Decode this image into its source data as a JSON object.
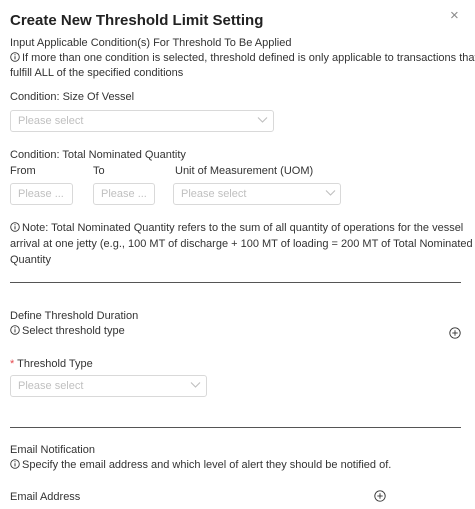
{
  "modal": {
    "title": "Create New Threshold Limit Setting",
    "close_icon": "×"
  },
  "conditions": {
    "heading": "Input Applicable Condition(s) For Threshold To Be Applied",
    "info_line1": "If more than one condition is selected, threshold defined is only applicable to transactions that",
    "info_line2": "fulfill ALL of the specified conditions"
  },
  "vessel_size": {
    "label": "Condition: Size Of Vessel",
    "placeholder": "Please select"
  },
  "nominated_quantity": {
    "label": "Condition: Total Nominated Quantity",
    "from_label": "From",
    "to_label": "To",
    "uom_label": "Unit of Measurement (UOM)",
    "from_placeholder": "Please ...",
    "to_placeholder": "Please ...",
    "uom_placeholder": "Please select",
    "note_line1": "Note: Total Nominated Quantity refers to the sum of all quantity of operations for the vessel",
    "note_line2": "arrival at one jetty (e.g., 100 MT of discharge + 100 MT of loading = 200 MT of Total Nominated",
    "note_line3": "Quantity"
  },
  "threshold_duration": {
    "heading": "Define Threshold Duration",
    "info": "Select threshold type",
    "type_required_mark": "*",
    "type_label": "Threshold Type",
    "type_placeholder": "Please select"
  },
  "email_notification": {
    "heading": "Email Notification",
    "info": "Specify the email address and which level of alert they should be notified of.",
    "address_label": "Email Address"
  },
  "icons": {
    "info": "info-circle-icon",
    "add": "plus-circle-icon",
    "dropdown": "chevron-down-icon",
    "close": "close-icon"
  }
}
